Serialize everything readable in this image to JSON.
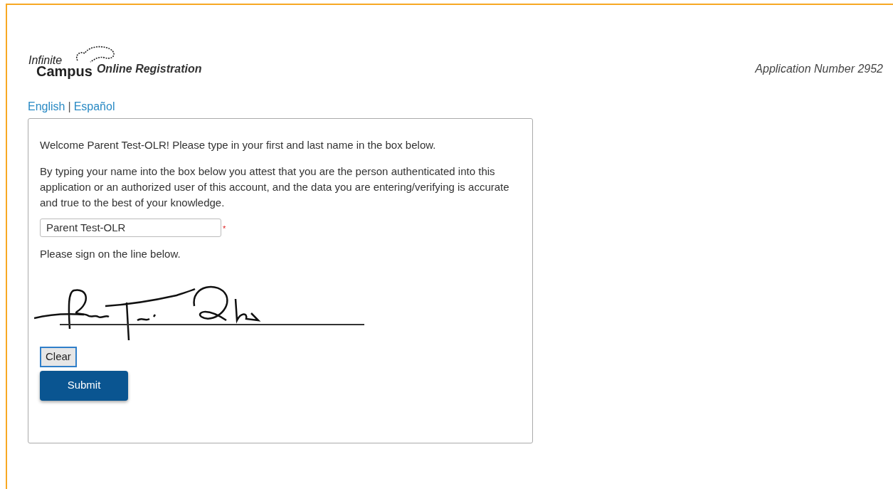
{
  "header": {
    "logo_top": "Infinite",
    "logo_bottom": "Campus",
    "product": "Online Registration",
    "application_number": "Application Number 2952"
  },
  "languages": [
    {
      "label": "English"
    },
    {
      "label": "Español"
    }
  ],
  "language_separator": "|",
  "form": {
    "welcome": "Welcome Parent Test-OLR! Please type in your first and last name in the box below.",
    "attestation": "By typing your name into the box below you attest that you are the person authenticated into this application or an authorized user of this account, and the data you are entering/verifying is accurate and true to the best of your knowledge.",
    "name_field": {
      "value": "Parent Test-OLR",
      "required_mark": "*"
    },
    "sign_prompt": "Please sign on the line below.",
    "buttons": [
      {
        "label": "Clear",
        "kind": "secondary"
      },
      {
        "label": "Submit",
        "kind": "primary"
      }
    ]
  }
}
